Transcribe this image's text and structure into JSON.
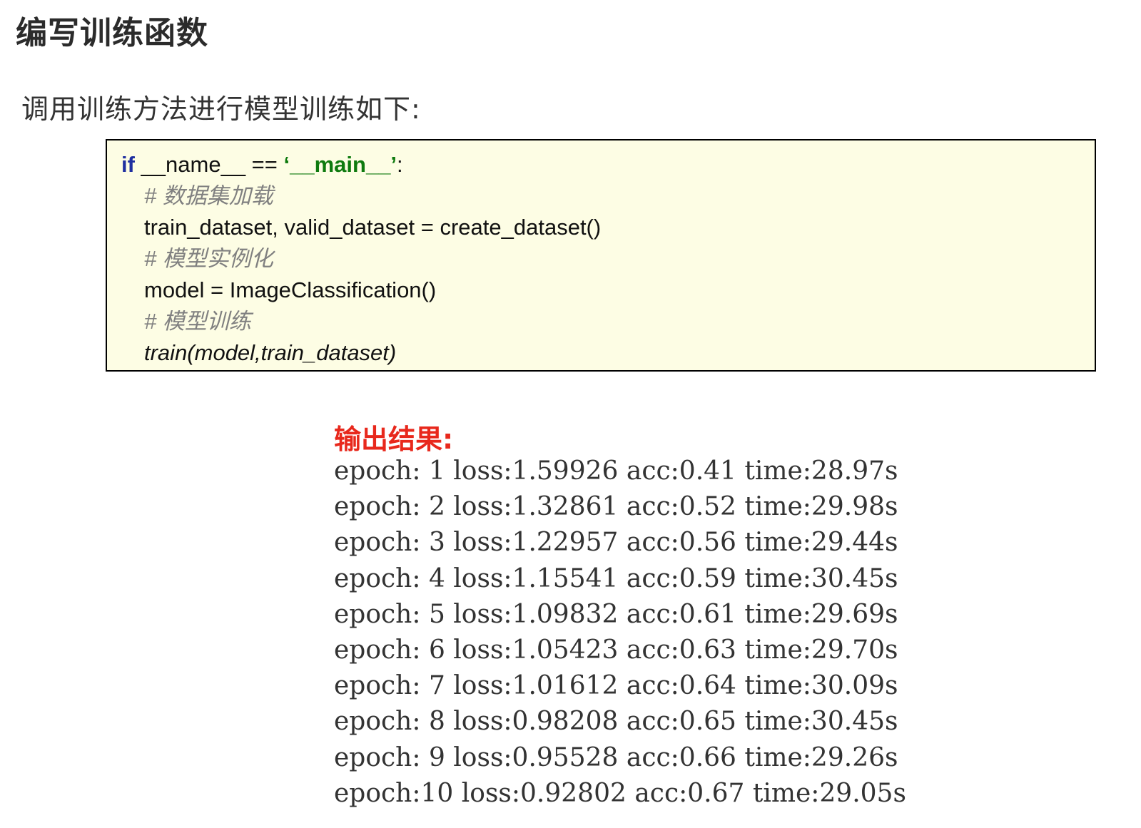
{
  "title": "编写训练函数",
  "intro": "调用训练方法进行模型训练如下:",
  "code": {
    "line1": {
      "kw": "if",
      "mid": " __name__ == ",
      "str": "‘__main__’",
      "end": ":"
    },
    "comment1": "# 数据集加载",
    "line2": "train_dataset, valid_dataset = create_dataset()",
    "comment2": "# 模型实例化",
    "line3": "model = ImageClassification()",
    "comment3": "# 模型训练",
    "line4": "train(model,train_dataset)"
  },
  "output": {
    "label": "输出结果:",
    "lines": [
      "epoch: 1 loss:1.59926 acc:0.41 time:28.97s",
      "epoch: 2 loss:1.32861 acc:0.52 time:29.98s",
      "epoch: 3 loss:1.22957 acc:0.56 time:29.44s",
      "epoch: 4 loss:1.15541 acc:0.59 time:30.45s",
      "epoch: 5 loss:1.09832 acc:0.61 time:29.69s",
      "epoch: 6 loss:1.05423 acc:0.63 time:29.70s",
      "epoch: 7 loss:1.01612 acc:0.64 time:30.09s",
      "epoch: 8 loss:0.98208 acc:0.65 time:30.45s",
      "epoch: 9 loss:0.95528 acc:0.66 time:29.26s",
      "epoch:10 loss:0.92802 acc:0.67 time:29.05s"
    ]
  }
}
